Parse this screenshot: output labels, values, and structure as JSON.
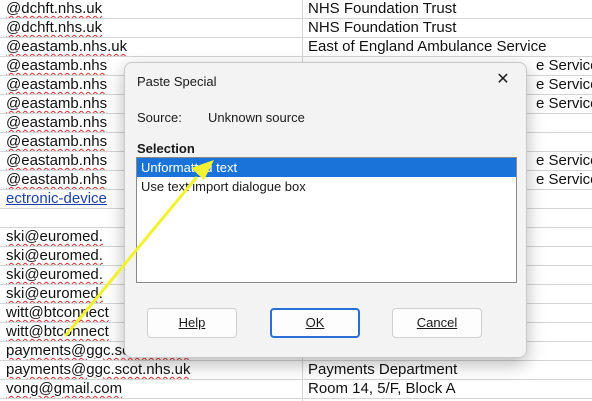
{
  "spreadsheet": {
    "rows": [
      {
        "a": "@dchft.nhs.uk",
        "b": "NHS Foundation Trust"
      },
      {
        "a": "@dchft.nhs.uk",
        "b": "NHS Foundation Trust"
      },
      {
        "a": "@eastamb.nhs.uk",
        "b": "East of England Ambulance Service"
      },
      {
        "a": "@eastamb.nhs",
        "b": "e Service"
      },
      {
        "a": "@eastamb.nhs",
        "b": "e Service"
      },
      {
        "a": "@eastamb.nhs",
        "b": "e Service"
      },
      {
        "a": "@eastamb.nhs",
        "b": ""
      },
      {
        "a": "@eastamb.nhs",
        "b": ""
      },
      {
        "a": "@eastamb.nhs",
        "b": "e Service"
      },
      {
        "a": "@eastamb.nhs",
        "b": "e Service"
      },
      {
        "a": "ectronic-device",
        "b": ""
      },
      {
        "a": "",
        "b": ""
      },
      {
        "a": "ski@euromed.",
        "b": ""
      },
      {
        "a": "ski@euromed.",
        "b": ""
      },
      {
        "a": "ski@euromed.",
        "b": ""
      },
      {
        "a": "ski@euromed.",
        "b": ""
      },
      {
        "a": "witt@btconnect",
        "b": ""
      },
      {
        "a": "witt@btconnect",
        "b": ""
      },
      {
        "a": "payments@ggc.scot.nhs.uk",
        "b": "Payments Department"
      },
      {
        "a": "payments@ggc.scot.nhs.uk",
        "b": "Payments Department"
      },
      {
        "a": "vong@gmail.com",
        "b": "Room 14, 5/F, Block A"
      }
    ]
  },
  "dialog": {
    "title": "Paste Special",
    "close_glyph": "✕",
    "source_label": "Source:",
    "source_value": "Unknown source",
    "selection_heading": "Selection",
    "options": [
      "Unformatted text",
      "Use text import dialogue box"
    ],
    "selected_option": "Unformatted text",
    "buttons": {
      "help": "Help",
      "ok": "OK",
      "cancel": "Cancel"
    }
  },
  "annotation": {
    "arrow_color": "#f2f230"
  }
}
